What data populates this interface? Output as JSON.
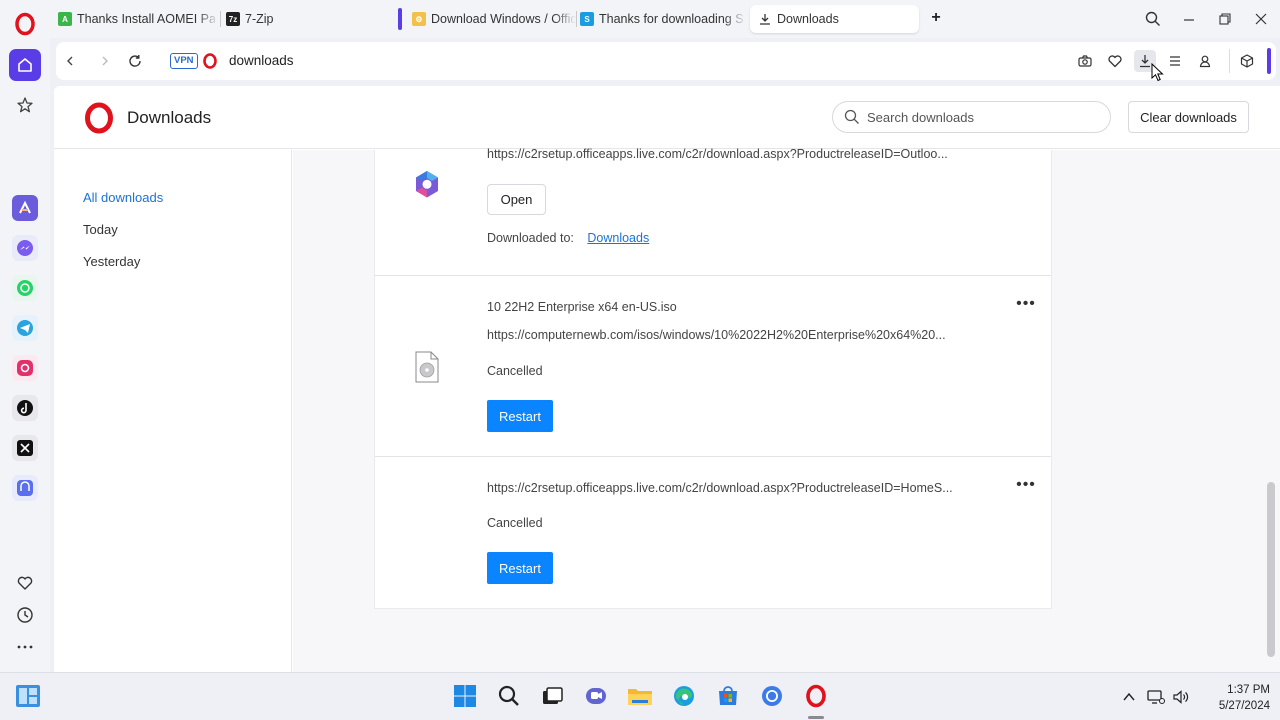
{
  "tabs": [
    {
      "title": "Thanks Install AOMEI Partition Assistant",
      "active": false
    },
    {
      "title": "7-Zip",
      "active": false
    },
    {
      "title": "Download Windows / Office",
      "active": false
    },
    {
      "title": "Thanks for downloading Setup",
      "active": false
    },
    {
      "title": "Downloads",
      "active": true
    }
  ],
  "address": {
    "vpn_label": "VPN",
    "url": "downloads"
  },
  "page": {
    "title": "Downloads",
    "search_placeholder": "Search downloads",
    "clear_label": "Clear downloads"
  },
  "sidebar": {
    "items": [
      {
        "label": "All downloads",
        "active": true
      },
      {
        "label": "Today",
        "active": false
      },
      {
        "label": "Yesterday",
        "active": false
      }
    ]
  },
  "downloads": [
    {
      "name": "",
      "url": "https://c2rsetup.officeapps.live.com/c2r/download.aspx?ProductreleaseID=Outloo...",
      "status": "",
      "action": "Open",
      "downloaded_to_label": "Downloaded to:",
      "downloaded_to_link": "Downloads",
      "icon": "microsoft-365-icon"
    },
    {
      "name": "10 22H2 Enterprise x64 en-US.iso",
      "url": "https://computernewb.com/isos/windows/10%2022H2%20Enterprise%20x64%20...",
      "status": "Cancelled",
      "action": "Restart",
      "icon": "disc-image-file-icon"
    },
    {
      "name": "",
      "url": "https://c2rsetup.officeapps.live.com/c2r/download.aspx?ProductreleaseID=HomeS...",
      "status": "Cancelled",
      "action": "Restart",
      "icon": ""
    }
  ],
  "more_glyph": "•••",
  "taskbar": {
    "time": "1:37 PM",
    "date": "5/27/2024"
  },
  "colors": {
    "accent": "#5b3de8",
    "opera_red": "#e0121b",
    "link": "#1a73d9",
    "restart_button": "#0a84ff"
  }
}
